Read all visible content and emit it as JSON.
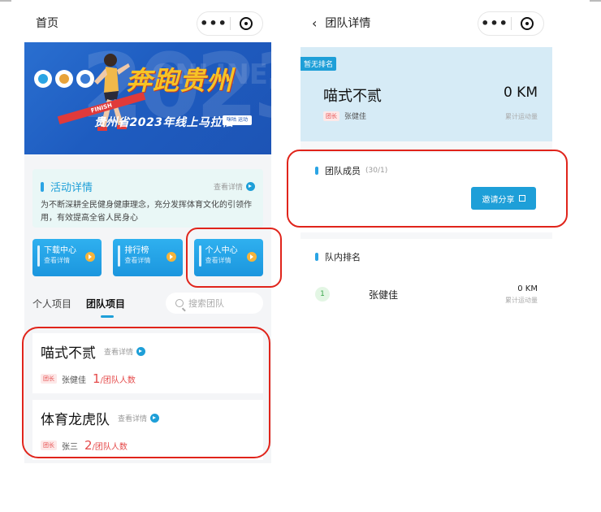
{
  "left_screen": {
    "nav_title": "首页",
    "banner": {
      "watermark_number": "2023",
      "watermark_side": "ONLINE",
      "ribbon": "FINISH",
      "slogan": "奔跑贵州",
      "subtitle": "贵州省2023年线上马拉松",
      "sponsor": "咪咕 运动"
    },
    "activity": {
      "title": "活动详情",
      "more": "查看详情",
      "description": "为不断深耕全民健身健康理念，充分发挥体育文化的引领作用，有效提高全省人民身心"
    },
    "buttons": [
      {
        "label": "下载中心",
        "sub": "查看详情"
      },
      {
        "label": "排行榜",
        "sub": "查看详情"
      },
      {
        "label": "个人中心",
        "sub": "查看详情"
      }
    ],
    "tabs": [
      {
        "label": "个人项目"
      },
      {
        "label": "团队项目"
      }
    ],
    "search_placeholder": "搜索团队",
    "teams": [
      {
        "name": "喵式不贰",
        "more": "查看详情",
        "tag": "团长",
        "leader": "张健佳",
        "count": "1",
        "count_label": "/团队人数"
      },
      {
        "name": "体育龙虎队",
        "more": "查看详情",
        "tag": "团长",
        "leader": "张三",
        "count": "2",
        "count_label": "/团队人数"
      }
    ]
  },
  "right_screen": {
    "back_icon": "‹",
    "nav_title": "团队详情",
    "badge": "暂无排名",
    "team_name": "喵式不贰",
    "team_km": "0 KM",
    "tag": "团长",
    "leader": "张健佳",
    "km_label": "累计运动量",
    "members": {
      "title": "团队成员",
      "count": "(30/1)",
      "invite": "邀请分享"
    },
    "ranking": {
      "title": "队内排名",
      "rows": [
        {
          "rank": "1",
          "name": "张健佳",
          "km": "0 KM",
          "km_label": "累计运动量"
        }
      ]
    }
  },
  "capsule": {
    "dots": "•••"
  },
  "colors": {
    "accent": "#1e9fd8",
    "annotation": "#e0241b",
    "tag_red": "#e54a4a"
  }
}
